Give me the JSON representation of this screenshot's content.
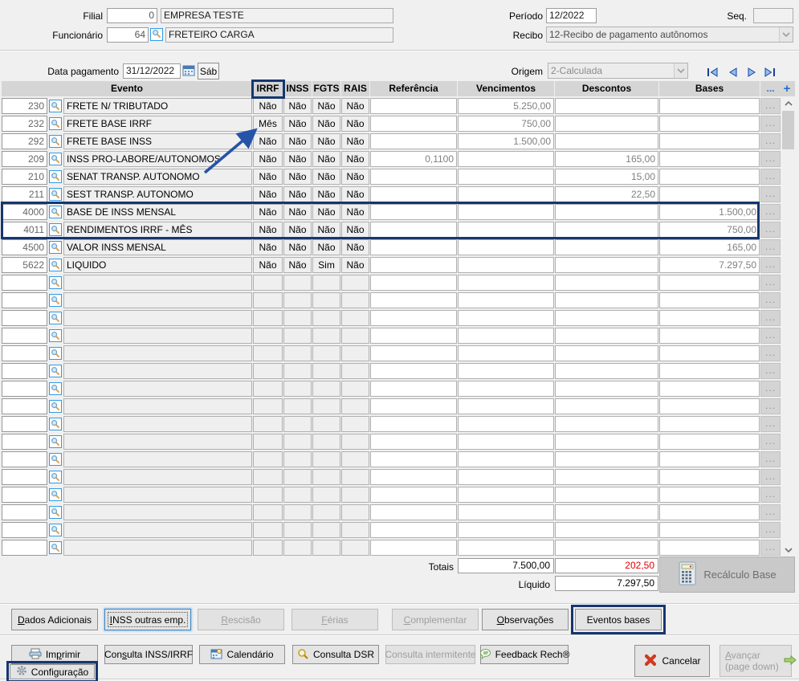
{
  "colors": {
    "annotation": "#16366f",
    "arrow": "#2553a8",
    "negative": "#e00000"
  },
  "header": {
    "filial": {
      "label": "Filial",
      "code": "0",
      "name": "EMPRESA TESTE"
    },
    "funcionario": {
      "label": "Funcionário",
      "code": "64",
      "name": "FRETEIRO CARGA"
    },
    "periodo": {
      "label": "Período",
      "value": "12/2022"
    },
    "seq": {
      "label": "Seq.",
      "value": ""
    },
    "recibo": {
      "label": "Recibo",
      "value": "12-Recibo de pagamento autônomos"
    }
  },
  "toolbar": {
    "data_pagamento": {
      "label": "Data pagamento",
      "value": "31/12/2022"
    },
    "weekday_button": "Sáb",
    "origem": {
      "label": "Origem",
      "value": "2-Calculada"
    },
    "nav_icons": [
      "first-record-icon",
      "previous-record-icon",
      "next-record-icon",
      "last-record-icon"
    ]
  },
  "table": {
    "headers": {
      "evento": "Evento",
      "irrf": "IRRF",
      "inss": "INSS",
      "fgts": "FGTS",
      "rais": "RAIS",
      "referencia": "Referência",
      "vencimentos": "Vencimentos",
      "descontos": "Descontos",
      "bases": "Bases",
      "more": "...",
      "add": "+"
    },
    "row_menu_label": "...",
    "empty_rows": 16,
    "rows": [
      {
        "code": "230",
        "evento": "FRETE N/ TRIBUTADO",
        "irrf": "Não",
        "inss": "Não",
        "fgts": "Não",
        "rais": "Não",
        "referencia": "",
        "vencimentos": "5.250,00",
        "descontos": "",
        "bases": ""
      },
      {
        "code": "232",
        "evento": "FRETE BASE IRRF",
        "irrf": "Mês",
        "inss": "Não",
        "fgts": "Não",
        "rais": "Não",
        "referencia": "",
        "vencimentos": "750,00",
        "descontos": "",
        "bases": ""
      },
      {
        "code": "292",
        "evento": "FRETE BASE INSS",
        "irrf": "Não",
        "inss": "Não",
        "fgts": "Não",
        "rais": "Não",
        "referencia": "",
        "vencimentos": "1.500,00",
        "descontos": "",
        "bases": ""
      },
      {
        "code": "209",
        "evento": "INSS PRO-LABORE/AUTONOMOS",
        "irrf": "Não",
        "inss": "Não",
        "fgts": "Não",
        "rais": "Não",
        "referencia": "0,1100",
        "vencimentos": "",
        "descontos": "165,00",
        "bases": ""
      },
      {
        "code": "210",
        "evento": "SENAT TRANSP. AUTONOMO",
        "irrf": "Não",
        "inss": "Não",
        "fgts": "Não",
        "rais": "Não",
        "referencia": "",
        "vencimentos": "",
        "descontos": "15,00",
        "bases": ""
      },
      {
        "code": "211",
        "evento": "SEST TRANSP. AUTONOMO",
        "irrf": "Não",
        "inss": "Não",
        "fgts": "Não",
        "rais": "Não",
        "referencia": "",
        "vencimentos": "",
        "descontos": "22,50",
        "bases": ""
      },
      {
        "code": "4000",
        "evento": "BASE DE INSS MENSAL",
        "irrf": "Não",
        "inss": "Não",
        "fgts": "Não",
        "rais": "Não",
        "referencia": "",
        "vencimentos": "",
        "descontos": "",
        "bases": "1.500,00",
        "annotated": true
      },
      {
        "code": "4011",
        "evento": "RENDIMENTOS IRRF - MÊS",
        "irrf": "Não",
        "inss": "Não",
        "fgts": "Não",
        "rais": "Não",
        "referencia": "",
        "vencimentos": "",
        "descontos": "",
        "bases": "750,00",
        "annotated": true
      },
      {
        "code": "4500",
        "evento": "VALOR INSS MENSAL",
        "irrf": "Não",
        "inss": "Não",
        "fgts": "Não",
        "rais": "Não",
        "referencia": "",
        "vencimentos": "",
        "descontos": "",
        "bases": "165,00"
      },
      {
        "code": "5622",
        "evento": "LIQUIDO",
        "irrf": "Não",
        "inss": "Não",
        "fgts": "Sim",
        "rais": "Não",
        "referencia": "",
        "vencimentos": "",
        "descontos": "",
        "bases": "7.297,50"
      }
    ]
  },
  "totals": {
    "totais_label": "Totais",
    "vencimentos_total": "7.500,00",
    "descontos_total": "202,50",
    "liquido_label": "Líquido",
    "liquido_value": "7.297,50",
    "recalculo_label": "Recálculo Base",
    "recalculo_icon": "calculator-icon"
  },
  "footer": {
    "row1": [
      {
        "label": "Dados Adicionais",
        "accel": "D",
        "state": "normal"
      },
      {
        "label": "INSS outras emp.",
        "accel": "I",
        "state": "focused"
      },
      {
        "label": "Rescisão",
        "accel": "R",
        "state": "disabled"
      },
      {
        "label": "Férias",
        "accel": "F",
        "state": "disabled"
      },
      {
        "label": "Complementar",
        "accel": "C",
        "state": "disabled"
      },
      {
        "label": "Observações",
        "accel": "O",
        "state": "normal"
      },
      {
        "label": "Eventos bases",
        "state": "normal",
        "annotated": true
      }
    ],
    "row2": [
      {
        "label": "Imprimir",
        "accel": "p",
        "icon": "printer-icon",
        "state": "normal"
      },
      {
        "label": "Consulta INSS/IRRF",
        "accel": "s",
        "state": "normal"
      },
      {
        "label": "Calendário",
        "icon": "calendar-icon",
        "state": "normal"
      },
      {
        "label": "Consulta DSR",
        "icon": "magnifier-icon",
        "state": "normal"
      },
      {
        "label": "Consulta intermitente",
        "state": "disabled"
      },
      {
        "label": "Feedback Rech®",
        "icon": "feedback-icon",
        "state": "normal"
      }
    ],
    "cancel": {
      "label": "Cancelar",
      "icon": "red-x-icon"
    },
    "advance": {
      "label": "Avançar",
      "sublabel": "(page down)",
      "accel": "A",
      "icon": "green-arrow-icon",
      "state": "disabled"
    },
    "config": {
      "label": "Configuração",
      "icon": "gear-icon",
      "annotated": true
    }
  }
}
